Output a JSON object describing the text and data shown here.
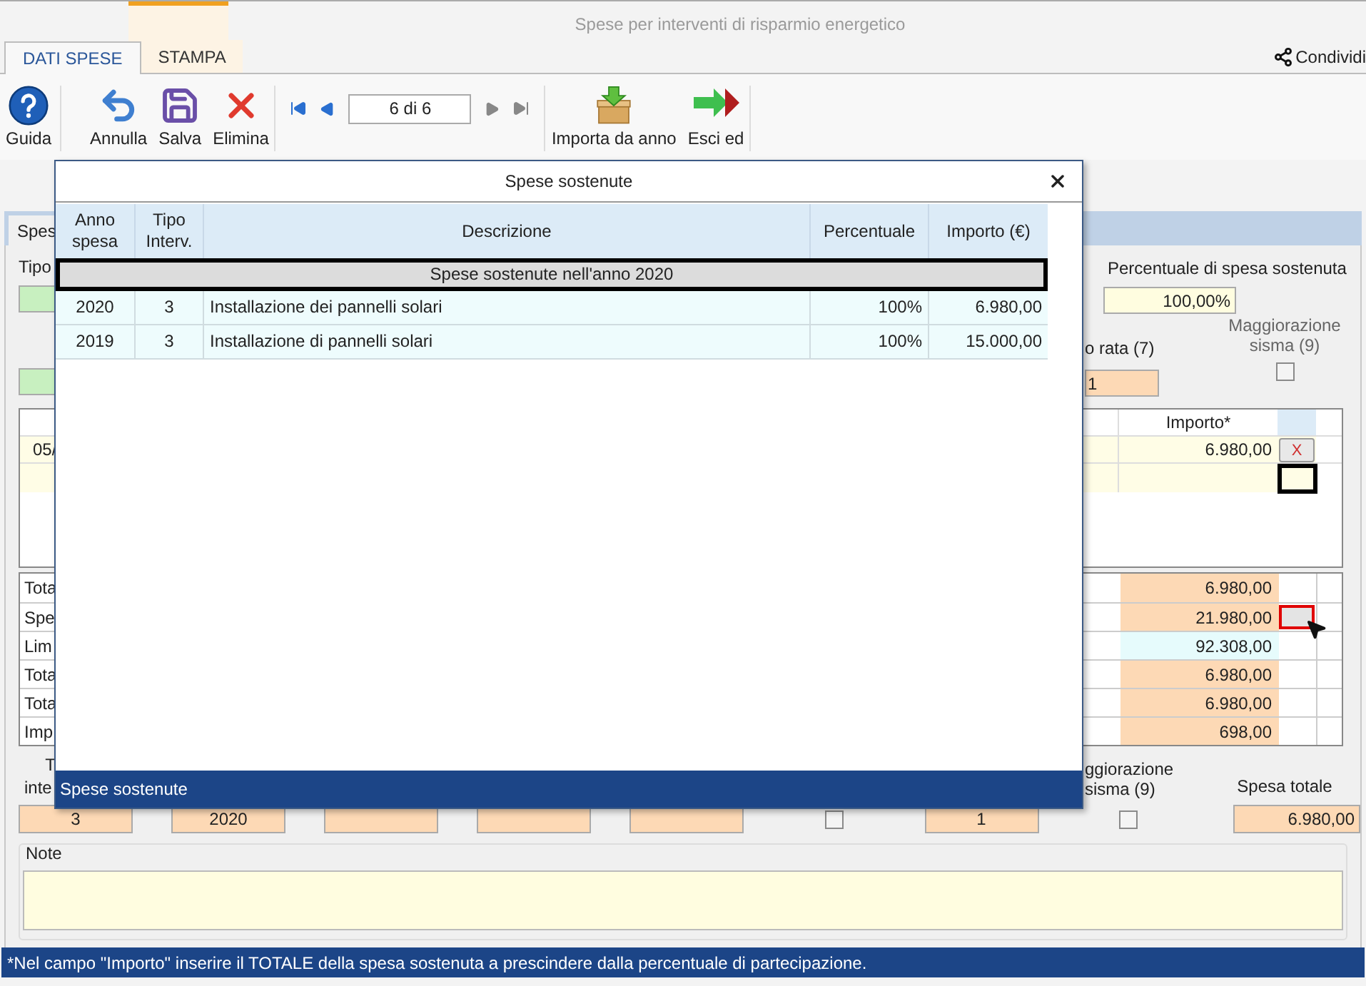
{
  "window": {
    "title": "Spese per interventi di risparmio energetico"
  },
  "ribbon_tabs": [
    {
      "label": "DATI SPESE",
      "selected": true
    },
    {
      "label": "STAMPA",
      "selected": false
    }
  ],
  "share": "Condividi",
  "toolbar": [
    {
      "kind": "help",
      "label": "Guida"
    },
    {
      "kind": "undo",
      "label": "Annulla"
    },
    {
      "kind": "save",
      "label": "Salva"
    },
    {
      "kind": "delete",
      "label": "Elimina"
    },
    {
      "kind": "navigator",
      "value": "6 di 6"
    },
    {
      "kind": "import",
      "label": "Importa da anno"
    },
    {
      "kind": "exit",
      "label": "Esci ed"
    }
  ],
  "form_tabs": [
    {
      "label": "Spes",
      "selected": true
    }
  ],
  "form": {
    "tipo_label": "Tipo",
    "percent_label": "Percentuale di spesa sostenuta",
    "percent_value": "100,00%",
    "rata_label": "o rata (7)",
    "rata_value": "1",
    "sisma_label": "Maggiorazione sisma (9)",
    "sisma_checked": false
  },
  "payments": {
    "header": "Importo*",
    "rows": [
      {
        "column_1": "05/",
        "importo": "6.980,00",
        "delete": "X"
      }
    ]
  },
  "totals": [
    {
      "label": "Tota",
      "value": "6.980,00",
      "kind": "amount"
    },
    {
      "label": "Spe",
      "value": "21.980,00",
      "kind": "detail"
    },
    {
      "label": "Lim",
      "value": "92.308,00",
      "kind": "limit"
    },
    {
      "label": "Tota",
      "value": "6.980,00",
      "kind": "amount"
    },
    {
      "label": "Tota",
      "value": "6.980,00",
      "kind": "amount"
    },
    {
      "label": "Imp",
      "value": "698,00",
      "kind": "amount"
    }
  ],
  "bottom": {
    "tipo_label": [
      "T",
      "inte"
    ],
    "sisma_label": [
      "ggiorazione",
      "sisma (9)"
    ],
    "total_label": "Spesa totale",
    "fields": [
      {
        "kind": "field",
        "value": "3"
      },
      {
        "kind": "field",
        "value": "2020"
      },
      {
        "kind": "field"
      },
      {
        "kind": "field"
      },
      {
        "kind": "field"
      },
      {
        "kind": "checkbox",
        "checked": false
      },
      {
        "kind": "field",
        "value": "1"
      },
      {
        "kind": "checkbox",
        "checked": false
      },
      {
        "kind": "total",
        "value": "6.980,00"
      }
    ]
  },
  "note": {
    "label": "Note"
  },
  "footnote": "*Nel campo \"Importo\" inserire il TOTALE della spesa sostenuta a prescindere dalla percentuale di partecipazione.",
  "dialog": {
    "title": "Spese sostenute",
    "columns": [
      "Anno spesa",
      "Tipo Interv.",
      "Descrizione",
      "Percentuale",
      "Importo (€)"
    ],
    "group": "Spese sostenute nell'anno 2020",
    "rows": [
      [
        "2020",
        "3",
        "Installazione dei pannelli solari",
        "100%",
        "6.980,00"
      ],
      [
        "2019",
        "3",
        "Installazione di pannelli solari",
        "100%",
        "15.000,00"
      ]
    ],
    "footer": "Spese sostenute"
  }
}
